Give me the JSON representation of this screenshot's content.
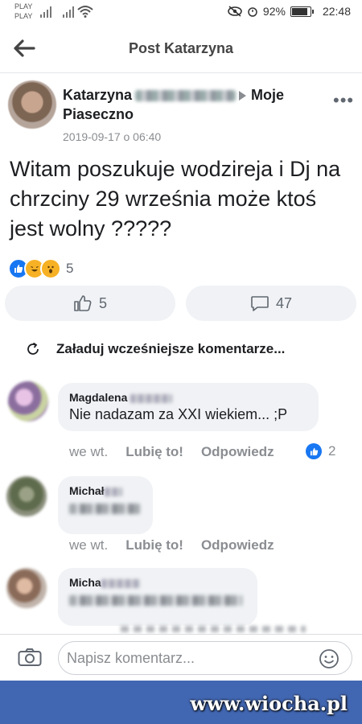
{
  "statusbar": {
    "carrier1": "PLAY",
    "carrier2": "PLAY",
    "battery": "92%",
    "time": "22:48"
  },
  "header": {
    "title": "Post Katarzyna",
    "back_icon": "arrow-left-icon"
  },
  "post": {
    "author_first": "Katarzyna",
    "group": "Moje Piaseczno",
    "date": "2019-09-17 o 06:40",
    "text": "Witam poszukuje wodzireja i Dj na chrzciny 29 września może ktoś jest wolny ?????",
    "reaction_count": "5",
    "like_count": "5",
    "comment_count": "47"
  },
  "load_previous": "Załaduj wcześniejsze komentarze...",
  "comments": [
    {
      "name": "Magdalena",
      "text": "Nie nadazam za XXI wiekiem... ;P",
      "time": "we wt.",
      "like": "Lubię to!",
      "reply": "Odpowiedz",
      "reactions": "2"
    },
    {
      "name": "Michał",
      "time": "we wt.",
      "like": "Lubię to!",
      "reply": "Odpowiedz"
    },
    {
      "name": "Micha"
    }
  ],
  "composer": {
    "placeholder": "Napisz komentarz..."
  },
  "watermark": "www.wiocha.pl",
  "colors": {
    "accent": "#1877f2",
    "bottom_bar": "#4267b2"
  }
}
